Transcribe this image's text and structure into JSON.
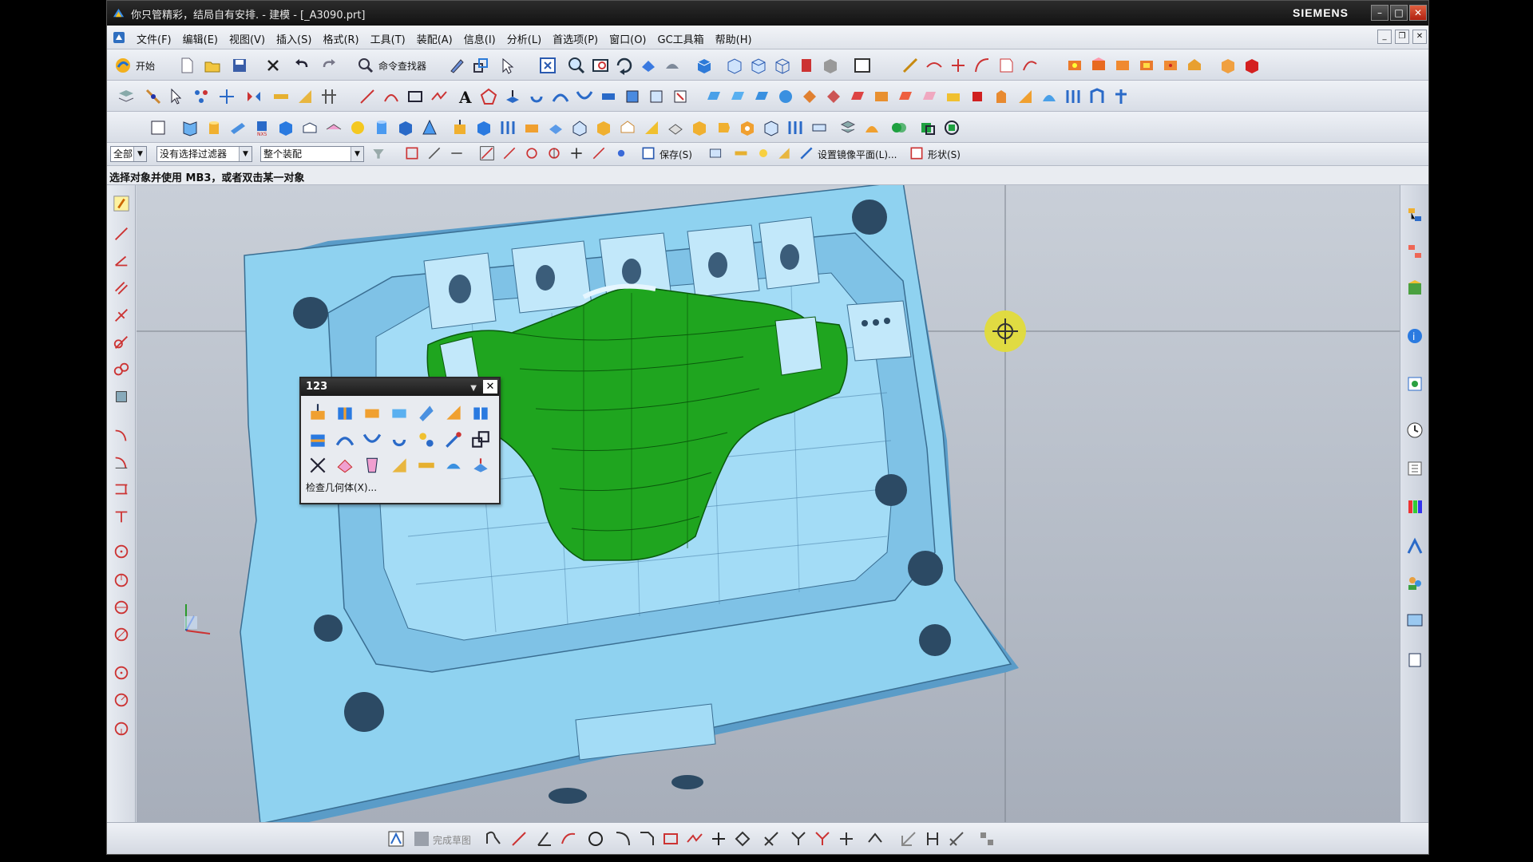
{
  "window": {
    "title": "你只管精彩，结局自有安排. - 建模 - [_A3090.prt]",
    "brand": "SIEMENS",
    "minimize": "–",
    "maximize": "□",
    "close": "✕"
  },
  "menubar": {
    "items": [
      {
        "label": "文件(F)"
      },
      {
        "label": "编辑(E)"
      },
      {
        "label": "视图(V)"
      },
      {
        "label": "插入(S)"
      },
      {
        "label": "格式(R)"
      },
      {
        "label": "工具(T)"
      },
      {
        "label": "装配(A)"
      },
      {
        "label": "信息(I)"
      },
      {
        "label": "分析(L)"
      },
      {
        "label": "首选项(P)"
      },
      {
        "label": "窗口(O)"
      },
      {
        "label": "GC工具箱"
      },
      {
        "label": "帮助(H)"
      }
    ]
  },
  "toolbar1": {
    "start_label": "开始",
    "command_finder_label": "命令查找器"
  },
  "selection_bar": {
    "type_filter": "全部",
    "selection_filter": "没有选择过滤器",
    "scope": "整个装配",
    "save_label": "保存(S)",
    "mirror_plane_label": "设置镜像平面(L)...",
    "shape_label": "形状(S)"
  },
  "cue_line": "选择对象并使用 MB3，或者双击某一对象",
  "palette": {
    "title": "123",
    "footer": "检查几何体(X)..."
  },
  "bottom_toolbar": {
    "finish_sketch_label": "完成草图"
  },
  "colors": {
    "mold_body": "#8fd2f0",
    "mold_shadow": "#5a9cc8",
    "part_green": "#1fa51f",
    "part_green_dark": "#0f7a12",
    "crosshair_ring": "#e2dc3a"
  }
}
